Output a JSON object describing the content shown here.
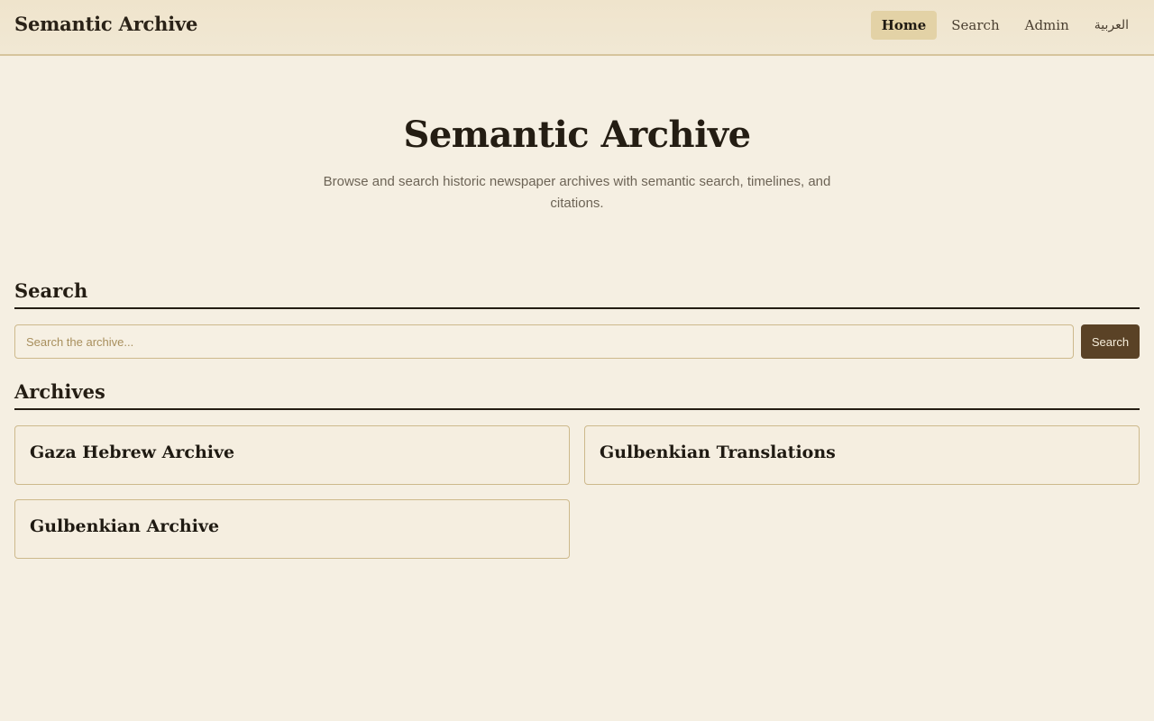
{
  "header": {
    "brand": "Semantic Archive",
    "nav": [
      {
        "label": "Home",
        "active": true
      },
      {
        "label": "Search",
        "active": false
      },
      {
        "label": "Admin",
        "active": false
      },
      {
        "label": "العربية",
        "active": false
      }
    ]
  },
  "hero": {
    "title": "Semantic Archive",
    "subtitle": "Browse and search historic newspaper archives with semantic search, timelines, and citations."
  },
  "search": {
    "heading": "Search",
    "placeholder": "Search the archive...",
    "button_label": "Search"
  },
  "archives": {
    "heading": "Archives",
    "items": [
      {
        "title": "Gaza Hebrew Archive"
      },
      {
        "title": "Gulbenkian Translations"
      },
      {
        "title": "Gulbenkian Archive"
      }
    ]
  },
  "colors": {
    "background": "#f5efe2",
    "accent": "#5a4226",
    "active_nav": "#e3d2a6",
    "border": "#cdb98c"
  }
}
